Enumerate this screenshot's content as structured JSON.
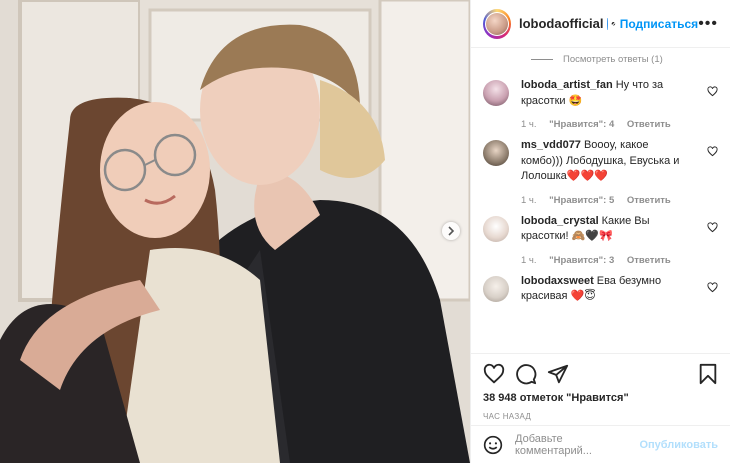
{
  "header": {
    "username": "lobodaofficial",
    "separator": "•",
    "follow_label": "Подписаться",
    "more_label": "•••"
  },
  "view_replies": "Посмотреть ответы (1)",
  "comments": [
    {
      "username": "loboda_artist_fan",
      "text": "Ну что за красотки 🤩",
      "time": "1 ч.",
      "likes": "\"Нравится\": 4",
      "reply": "Ответить",
      "avatar_color": "#c9a0b0"
    },
    {
      "username": "ms_vdd077",
      "text": "Вооoу, какое комбо))) Лободушка, Евуська и Лолошка❤️❤️❤️",
      "time": "1 ч.",
      "likes": "\"Нравится\": 5",
      "reply": "Ответить",
      "avatar_color": "#8a7a6a"
    },
    {
      "username": "loboda_crystal",
      "text": "Какие Вы красотки! 🙈🖤🎀",
      "time": "1 ч.",
      "likes": "\"Нравится\": 3",
      "reply": "Ответить",
      "avatar_color": "#e7d9d1"
    },
    {
      "username": "lobodaxsweet",
      "text": "Ева безумно красивая ❤️😇",
      "time": "",
      "likes": "",
      "reply": "",
      "avatar_color": "#d8d0c8"
    }
  ],
  "likes_count": "38 948 отметок \"Нравится\"",
  "timestamp": "ЧАС НАЗАД",
  "add_comment": {
    "placeholder": "Добавьте комментарий...",
    "publish_label": "Опубликовать"
  },
  "icons": {
    "like": "heart-icon",
    "comment": "comment-icon",
    "share": "share-icon",
    "save": "bookmark-icon",
    "emoji": "smile-icon",
    "next": "chevron-right-icon"
  },
  "colors": {
    "accent": "#0095f6",
    "verified": "#3897f0",
    "muted": "#8e8e8e"
  }
}
